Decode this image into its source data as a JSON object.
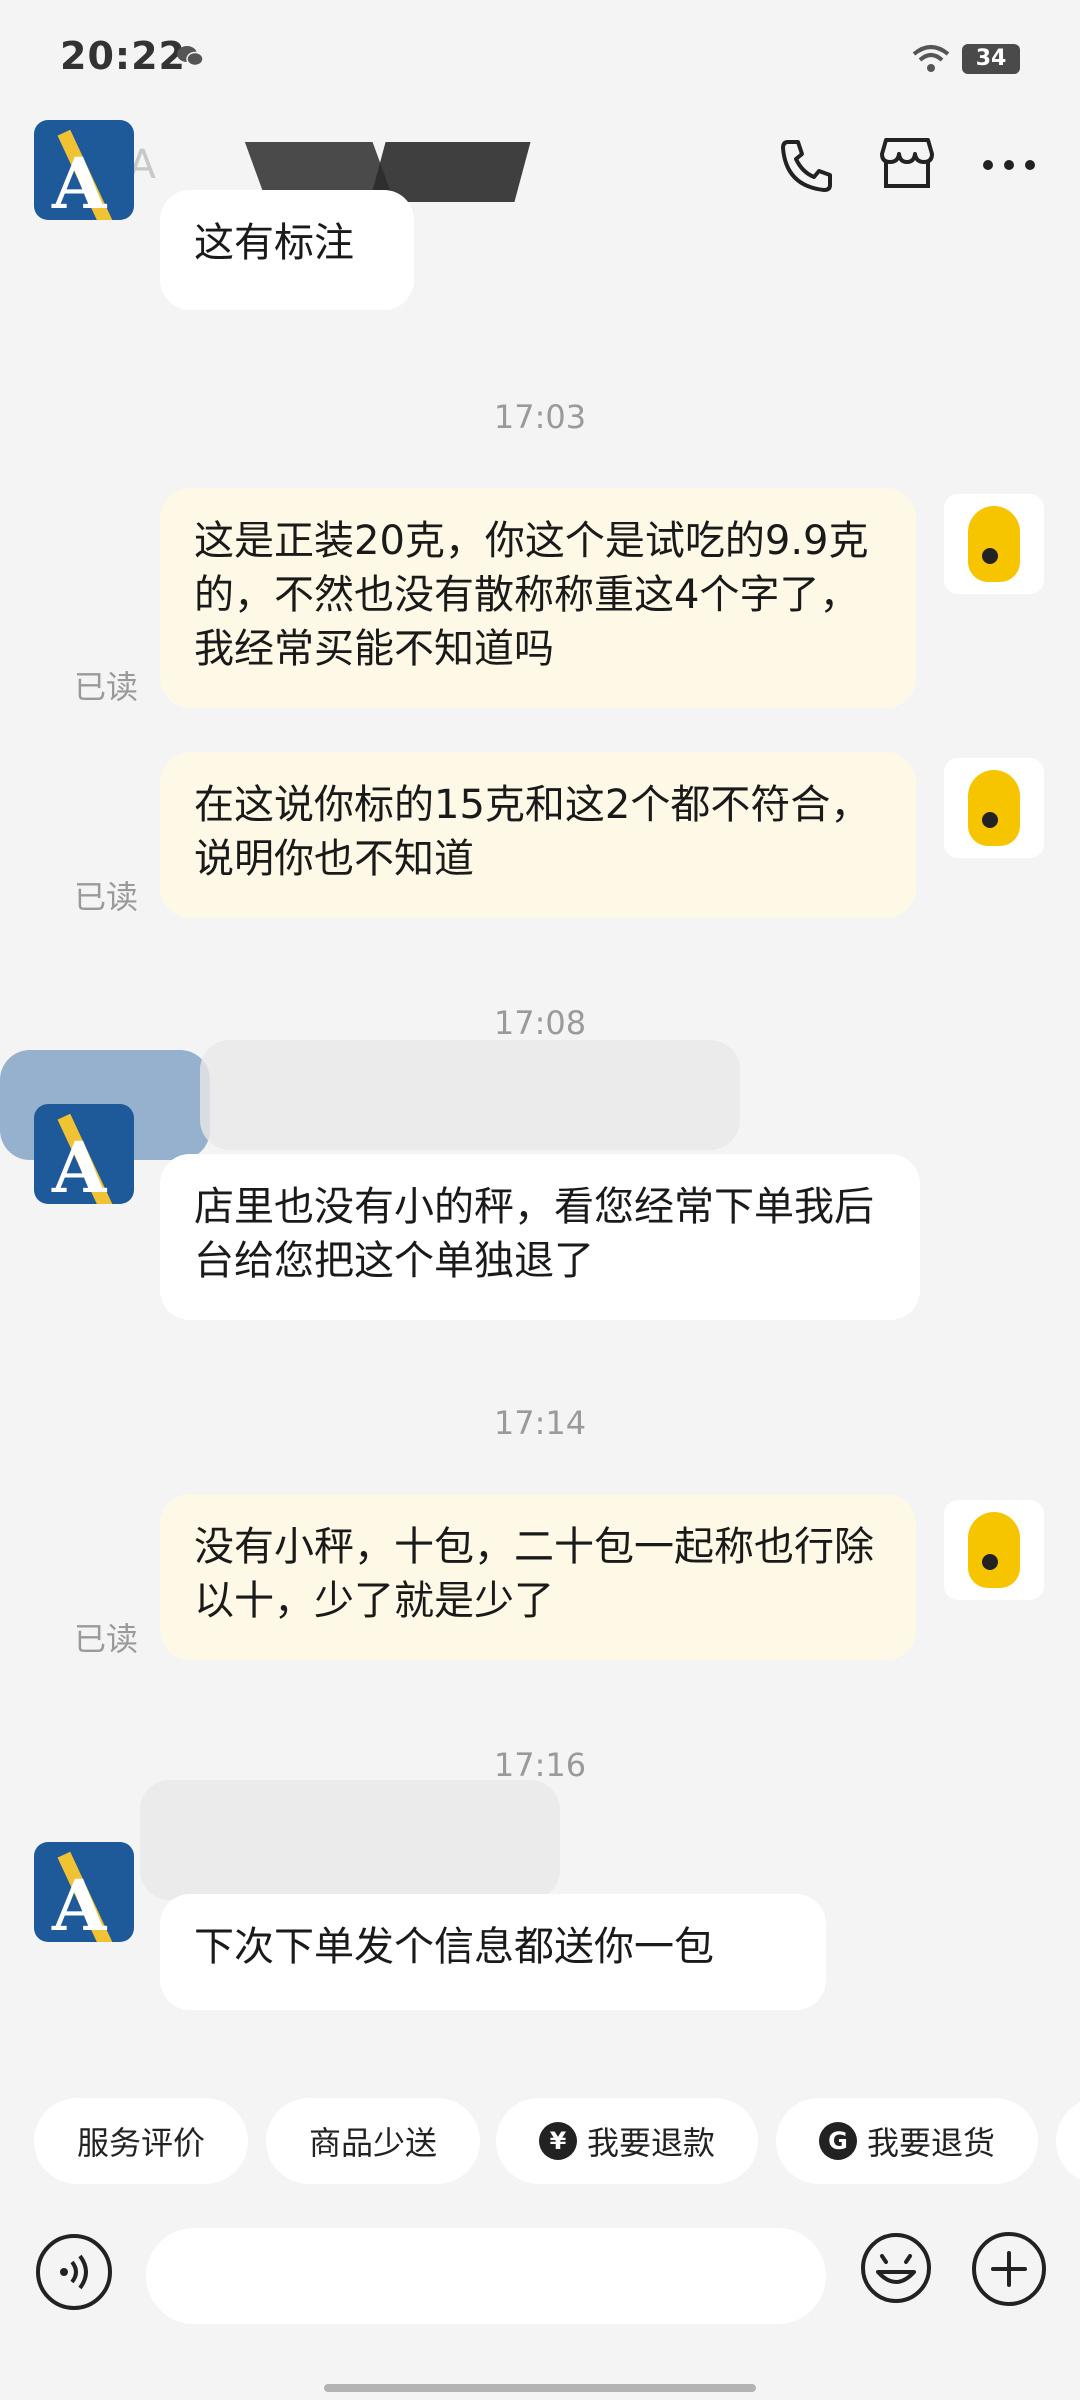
{
  "status_bar": {
    "time": "20:22",
    "battery": "34"
  },
  "header": {
    "title": "AA"
  },
  "messages": [
    {
      "text": "这有标注"
    },
    {
      "time": "17:03",
      "text": "这是正装20克，你这个是试吃的9.9克的，不然也没有散称称重这4个字了，我经常买能不知道吗",
      "status": "已读"
    },
    {
      "text": "在这说你标的15克和这2个都不符合，说明你也不知道",
      "status": "已读"
    },
    {
      "time": "17:08",
      "text": "店里也没有小的秤，看您经常下单我后台给您把这个单独退了"
    },
    {
      "time": "17:14",
      "text": "没有小秤，十包，二十包一起称也行除以十，少了就是少了",
      "status": "已读"
    },
    {
      "time": "17:16",
      "text": "下次下单发个信息都送你一包"
    }
  ],
  "quick_actions": [
    {
      "label": "服务评价"
    },
    {
      "label": "商品少送"
    },
    {
      "label": "我要退款",
      "icon": "¥"
    },
    {
      "label": "我要退货",
      "icon": "G"
    }
  ],
  "input": {
    "placeholder": ""
  }
}
